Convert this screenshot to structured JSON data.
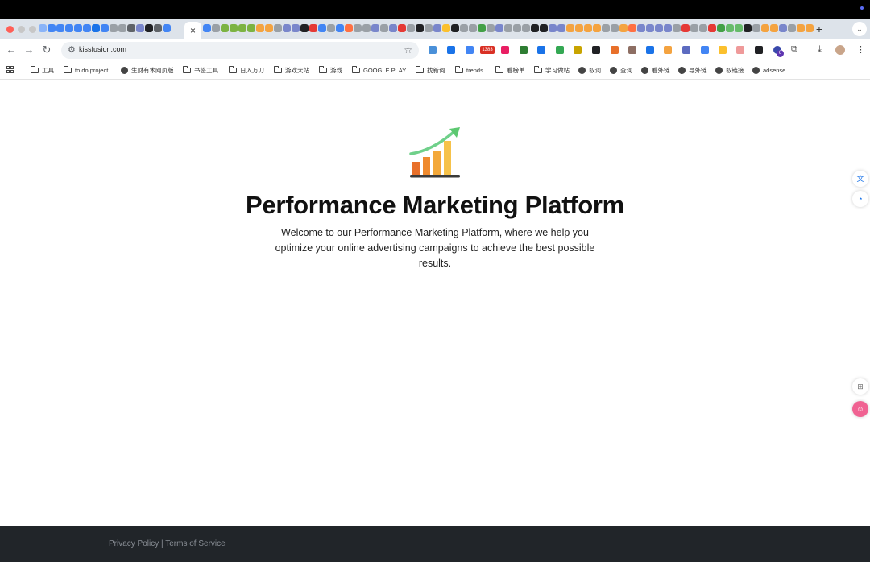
{
  "browser": {
    "url": "kissfusion.com",
    "active_tab_close": "×",
    "new_tab": "+",
    "tab_menu": "⌄",
    "bookmarks": [
      {
        "label": "工具",
        "icon": "folder-icon"
      },
      {
        "label": "to do project",
        "icon": "folder-icon"
      },
      {
        "label": "生财有术网页版",
        "icon": "globe-icon"
      },
      {
        "label": "书签工具",
        "icon": "folder-icon"
      },
      {
        "label": "日入万刀",
        "icon": "folder-icon"
      },
      {
        "label": "游戏大站",
        "icon": "folder-icon"
      },
      {
        "label": "游戏",
        "icon": "folder-icon"
      },
      {
        "label": "GOOGLE PLAY",
        "icon": "folder-icon"
      },
      {
        "label": "找新词",
        "icon": "folder-icon"
      },
      {
        "label": "trends",
        "icon": "folder-icon"
      },
      {
        "label": "看榜单",
        "icon": "folder-icon"
      },
      {
        "label": "学习做站",
        "icon": "folder-icon"
      },
      {
        "label": "取词",
        "icon": "globe-icon"
      },
      {
        "label": "查词",
        "icon": "globe-icon"
      },
      {
        "label": "看外链",
        "icon": "globe-icon"
      },
      {
        "label": "导外链",
        "icon": "globe-icon"
      },
      {
        "label": "取链接",
        "icon": "globe-icon"
      },
      {
        "label": "adsense",
        "icon": "globe-icon"
      }
    ],
    "extension_badge": "1383",
    "extension_count": "6"
  },
  "page": {
    "title": "Performance Marketing Platform",
    "subtitle": "Welcome to our Performance Marketing Platform, where we help you optimize your online advertising campaigns to achieve the best possible results.",
    "logo_icon": "bar-chart-growth-icon"
  },
  "footer": {
    "privacy": "Privacy Policy",
    "separator": " | ",
    "terms": "Terms of Service"
  },
  "colors": {
    "footer_bg": "#212529",
    "tabstrip_bg": "#dde3ea",
    "bar_orange": "#e8702a",
    "bar_yellow": "#f6c24a",
    "arrow_green": "#5cc870"
  }
}
